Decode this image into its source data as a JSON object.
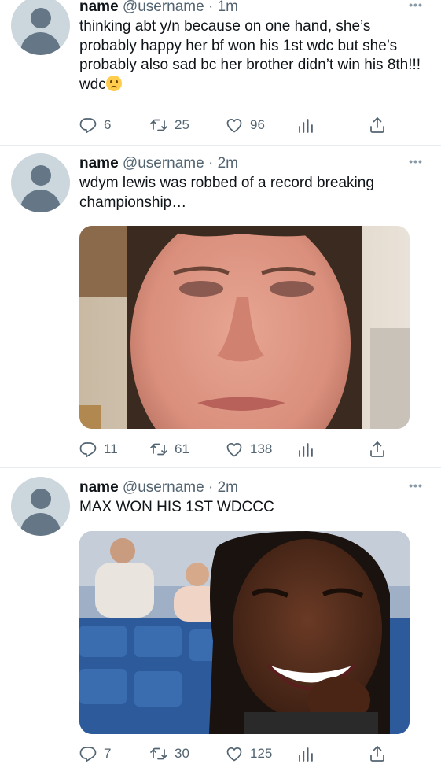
{
  "tweets": [
    {
      "name": "name",
      "handle": "@username",
      "separator": "·",
      "time": "1m",
      "text": "thinking abt y/n because on one hand, she’s probably happy her bf won his 1st wdc but she’s probably also sad bc her brother didn’t win his 8th!!! wdc",
      "emoji": "slightly-frowning-face",
      "replies": "6",
      "retweets": "25",
      "likes": "96"
    },
    {
      "name": "name",
      "handle": "@username",
      "separator": "·",
      "time": "2m",
      "text": "wdym lewis was robbed of a record breaking championship…",
      "media": "photo-crying-woman",
      "replies": "11",
      "retweets": "61",
      "likes": "138"
    },
    {
      "name": "name",
      "handle": "@username",
      "separator": "·",
      "time": "2m",
      "text": "MAX WON HIS 1ST WDCCC",
      "media": "photo-laughing-woman-stadium",
      "replies": "7",
      "retweets": "30",
      "likes": "125"
    }
  ],
  "more_glyph": "•••",
  "colors": {
    "text": "#0f1419",
    "secondary": "#536471",
    "divider": "#e6ecf0",
    "avatar_bg": "#ccd6dd",
    "avatar_fg": "#657786"
  }
}
